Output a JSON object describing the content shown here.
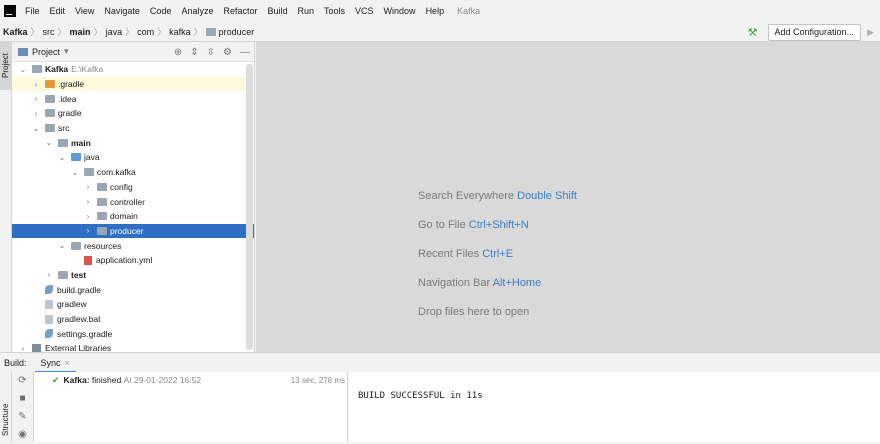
{
  "menubar": {
    "items": [
      "File",
      "Edit",
      "View",
      "Navigate",
      "Code",
      "Analyze",
      "Refactor",
      "Build",
      "Run",
      "Tools",
      "VCS",
      "Window",
      "Help"
    ],
    "title": "Kafka"
  },
  "breadcrumbs": [
    "Kafka",
    "src",
    "main",
    "java",
    "com",
    "kafka",
    "producer"
  ],
  "toolbar": {
    "add_config_label": "Add Configuration..."
  },
  "sidebar": {
    "project_tab": "Project",
    "structure_tab": "Structure"
  },
  "project_panel": {
    "header": "Project",
    "tree": [
      {
        "label": "Kafka",
        "suffix": "E:\\Kafka",
        "arrow": "v",
        "indent": 0,
        "icon": "folder-gray",
        "bold": true
      },
      {
        "label": ".gradle",
        "arrow": ">",
        "indent": 1,
        "icon": "folder-orange",
        "highlight": true
      },
      {
        "label": ".idea",
        "arrow": ">",
        "indent": 1,
        "icon": "folder-gray"
      },
      {
        "label": "gradle",
        "arrow": ">",
        "indent": 1,
        "icon": "folder-gray"
      },
      {
        "label": "src",
        "arrow": "v",
        "indent": 1,
        "icon": "folder-gray"
      },
      {
        "label": "main",
        "arrow": "v",
        "indent": 2,
        "icon": "folder-gray",
        "bold": true
      },
      {
        "label": "java",
        "arrow": "v",
        "indent": 3,
        "icon": "folder-blue"
      },
      {
        "label": "com.kafka",
        "arrow": "v",
        "indent": 4,
        "icon": "folder-gray"
      },
      {
        "label": "config",
        "arrow": ">",
        "indent": 5,
        "icon": "folder-gray"
      },
      {
        "label": "controller",
        "arrow": ">",
        "indent": 5,
        "icon": "folder-gray"
      },
      {
        "label": "domain",
        "arrow": ">",
        "indent": 5,
        "icon": "folder-gray"
      },
      {
        "label": "producer",
        "arrow": ">",
        "indent": 5,
        "icon": "folder-gray",
        "selected": true
      },
      {
        "label": "resources",
        "arrow": "v",
        "indent": 3,
        "icon": "folder-gray"
      },
      {
        "label": "application.yml",
        "arrow": "",
        "indent": 4,
        "icon": "yml-file"
      },
      {
        "label": "test",
        "arrow": ">",
        "indent": 2,
        "icon": "folder-gray",
        "bold": true
      },
      {
        "label": "build.gradle",
        "arrow": "",
        "indent": 1,
        "icon": "gradle-file"
      },
      {
        "label": "gradlew",
        "arrow": "",
        "indent": 1,
        "icon": "file"
      },
      {
        "label": "gradlew.bat",
        "arrow": "",
        "indent": 1,
        "icon": "file"
      },
      {
        "label": "settings.gradle",
        "arrow": "",
        "indent": 1,
        "icon": "gradle-file"
      },
      {
        "label": "External Libraries",
        "arrow": ">",
        "indent": 0,
        "icon": "library"
      }
    ]
  },
  "editor": {
    "hints": [
      {
        "text": "Search Everywhere",
        "key": "Double Shift"
      },
      {
        "text": "Go to File",
        "key": "Ctrl+Shift+N"
      },
      {
        "text": "Recent Files",
        "key": "Ctrl+E"
      },
      {
        "text": "Navigation Bar",
        "key": "Alt+Home"
      },
      {
        "text": "Drop files here to open",
        "key": ""
      }
    ]
  },
  "build": {
    "label": "Build:",
    "tab": "Sync",
    "task_name": "Kafka:",
    "task_status": "finished",
    "task_time": "At 29-01-2022 16:52",
    "duration": "13 sec, 278 ms",
    "output": "BUILD SUCCESSFUL in 11s"
  }
}
